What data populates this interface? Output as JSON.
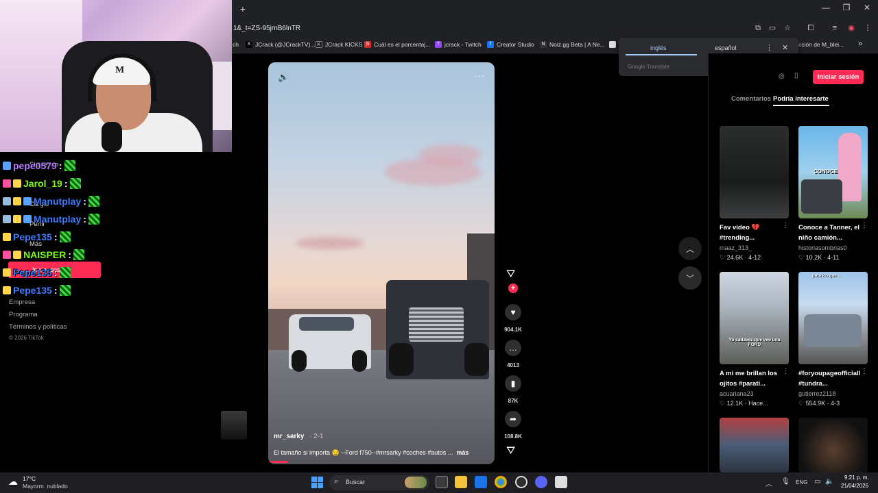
{
  "browser": {
    "new_tab": "+",
    "url": "1&_t=ZS-95jrnB6lnTR",
    "window_controls": [
      "—",
      "❐",
      "✕"
    ],
    "bookmarks": [
      {
        "label": "ch",
        "icon": ""
      },
      {
        "label": "JCrack (@JCrackTV)...",
        "icon": "X"
      },
      {
        "label": "JCrack KICKS",
        "icon": "K"
      },
      {
        "label": "Cuál es el porcentaj...",
        "icon": "S"
      },
      {
        "label": "jcrack - Twitch",
        "icon": "T"
      },
      {
        "label": "Creator Studio",
        "icon": "f"
      },
      {
        "label": "Noiz.gg Beta | A Ne...",
        "icon": "N"
      },
      {
        "label": "cción de M_blei...",
        "icon": ""
      }
    ],
    "bookmarks_more": "»"
  },
  "translate": {
    "lang_source": "inglés",
    "lang_target": "español",
    "menu": "⋮",
    "close": "✕",
    "provider": "Google Translate"
  },
  "chat": {
    "messages": [
      {
        "user": "pepe0579",
        "color": "#b57cff",
        "badges": [
          "#5aa0ff"
        ]
      },
      {
        "user": "Jarol_19",
        "color": "#7cfc00",
        "badges": [
          "#ff4fa0",
          "#ffd54a"
        ]
      },
      {
        "user": "Manutplay",
        "color": "#3b7bff",
        "badges": [
          "#9bd",
          "#ffd54a",
          "#5aa0ff"
        ]
      },
      {
        "user": "Manutplay",
        "color": "#3b7bff",
        "badges": [
          "#9bd",
          "#ffd54a",
          "#5aa0ff"
        ]
      },
      {
        "user": "Pepe135",
        "color": "#3b7bff",
        "badges": [
          "#ffd54a"
        ]
      },
      {
        "user": "NAISPER",
        "color": "#7cfc00",
        "badges": [
          "#ff4fa0",
          "#ffd54a"
        ]
      },
      {
        "user": "Pepe135",
        "color": "#3b7bff",
        "badges": [
          "#ffd54a"
        ]
      },
      {
        "user": "Pepe135",
        "color": "#3b7bff",
        "badges": [
          "#ffd54a"
        ]
      }
    ],
    "separator": ":"
  },
  "left_nav": {
    "items": [
      "Siguiendo",
      "Cargar",
      "Perfil",
      "Más"
    ],
    "login_button": "Iniciar sesión",
    "footer": [
      "Empresa",
      "Programa",
      "Términos y políticas",
      "© 2026 TikTok"
    ]
  },
  "video": {
    "username": "mr_sarky",
    "date": "· 2-1",
    "caption": "El tamaño si importa 😏 --Ford f750--#mrsarky #coches #autos ...",
    "more": "más",
    "progress": 0.085,
    "likes": "904.1K",
    "comments": "4013",
    "saves": "87K",
    "shares": "108.8K"
  },
  "right_panel": {
    "login_button": "Iniciar sesión",
    "tabs": [
      "Comentarios",
      "Podría interesarte"
    ],
    "active_tab": "Podría interesarte",
    "cards": [
      {
        "title": "Fav video 💔 #trending...",
        "author": "maaz_313_",
        "likes": "24.6K",
        "date": "4-12",
        "thumb_text": ""
      },
      {
        "title": "Conoce a Tanner, el niño camión...",
        "author": "historiasombrias0",
        "likes": "10.2K",
        "date": "4-11",
        "thumb_text": "CONOCE"
      },
      {
        "title": "A mi me brillan los ojitos #parati...",
        "author": "acuariana23",
        "likes": "12.1K",
        "date": "Hace...",
        "thumb_text": "Yo cadavez que veo una FORD"
      },
      {
        "title": "#foryoupageofficiall #tundra...",
        "author": "gutierrez2118",
        "likes": "554.9K",
        "date": "4-3",
        "thumb_text": "para los que..."
      }
    ]
  },
  "taskbar": {
    "weather_temp": "17°C",
    "weather_desc": "Mayorm. nublado",
    "search_placeholder": "Buscar",
    "language": "ENG",
    "time": "9:21 p. m.",
    "date": "21/04/2026"
  }
}
